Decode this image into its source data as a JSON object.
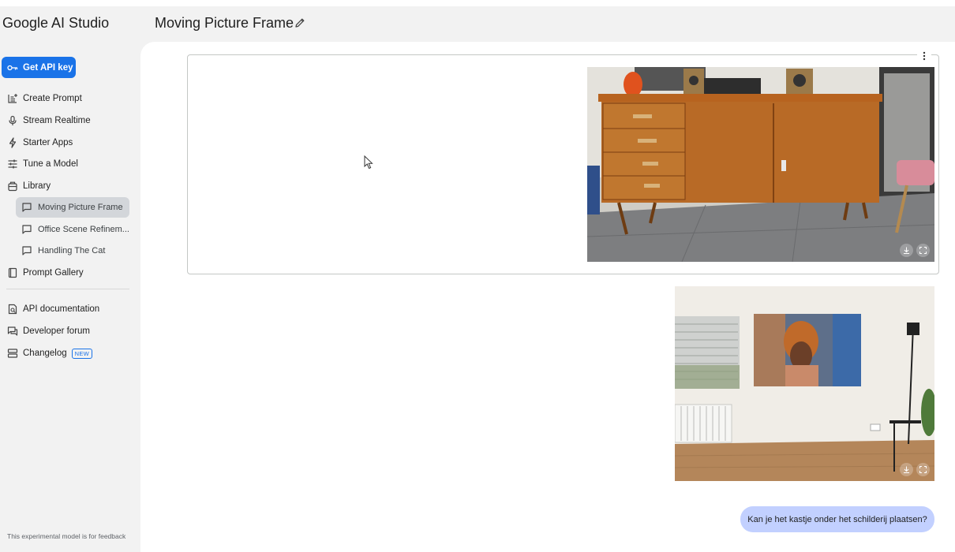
{
  "header": {
    "brand": "Google AI Studio",
    "title": "Moving Picture Frame"
  },
  "sidebar": {
    "api_key_label": "Get API key",
    "nav": [
      {
        "label": "Create Prompt",
        "icon": "create-prompt-icon"
      },
      {
        "label": "Stream Realtime",
        "icon": "microphone-icon"
      },
      {
        "label": "Starter Apps",
        "icon": "bolt-icon"
      },
      {
        "label": "Tune a Model",
        "icon": "tune-icon"
      },
      {
        "label": "Library",
        "icon": "library-icon"
      }
    ],
    "library_items": [
      {
        "label": "Moving Picture Frame",
        "active": true
      },
      {
        "label": "Office Scene Refinem...",
        "active": false
      },
      {
        "label": "Handling The Cat",
        "active": false
      }
    ],
    "prompt_gallery": "Prompt Gallery",
    "resources": [
      {
        "label": "API documentation",
        "icon": "api-docs-icon"
      },
      {
        "label": "Developer forum",
        "icon": "forum-icon"
      },
      {
        "label": "Changelog",
        "icon": "changelog-icon",
        "badge": "NEW"
      }
    ],
    "footnote": "This experimental model is for feedback"
  },
  "chat": {
    "user_message": "Kan je het kastje onder het schilderij plaatsen?"
  },
  "colors": {
    "accent": "#1a73e8",
    "user_bubble": "#c2d0ff",
    "sidebar_active": "#d3d6da"
  }
}
